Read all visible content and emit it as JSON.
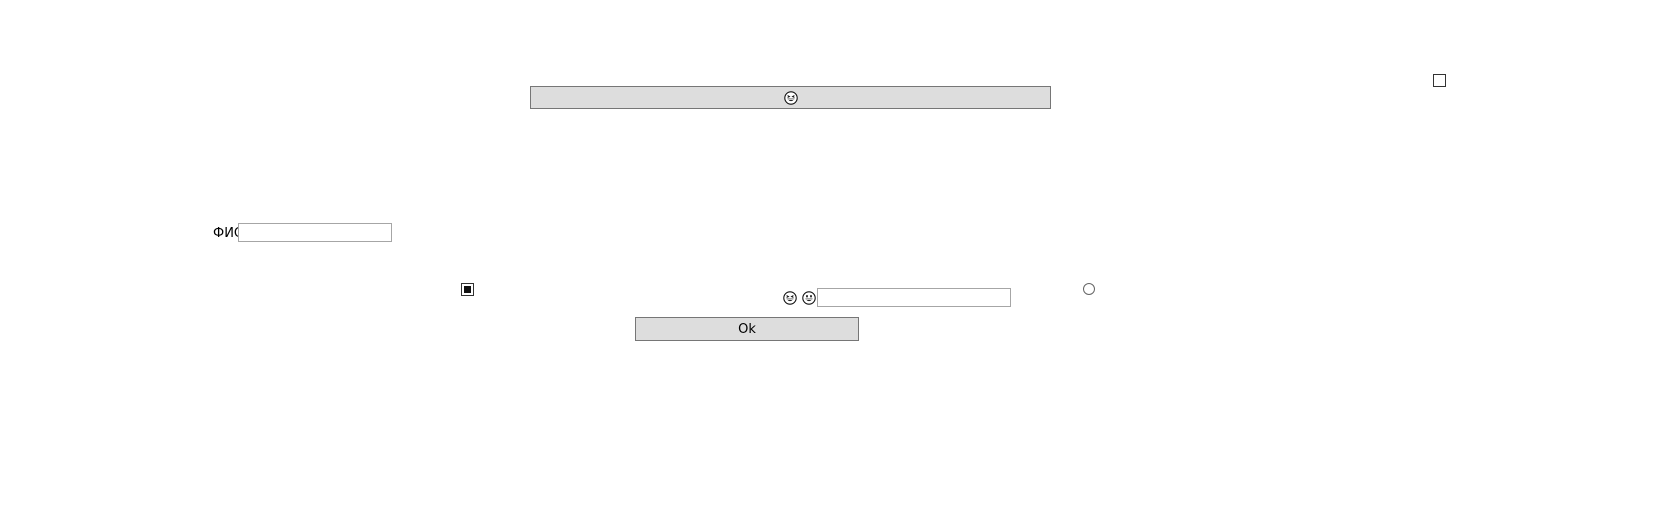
{
  "top_button": {
    "icon": "grinning-squinting-face-icon"
  },
  "top_checkbox": {
    "checked": false
  },
  "fio_field": {
    "label": "ФИО",
    "value": "",
    "placeholder": ""
  },
  "left_checkbox": {
    "checked": true
  },
  "right_radio": {
    "checked": false
  },
  "emoji_row": {
    "icons": [
      "grinning-squinting-face-icon",
      "grinning-face-icon"
    ],
    "input_value": "",
    "input_placeholder": ""
  },
  "ok_button": {
    "label": "Ok"
  }
}
